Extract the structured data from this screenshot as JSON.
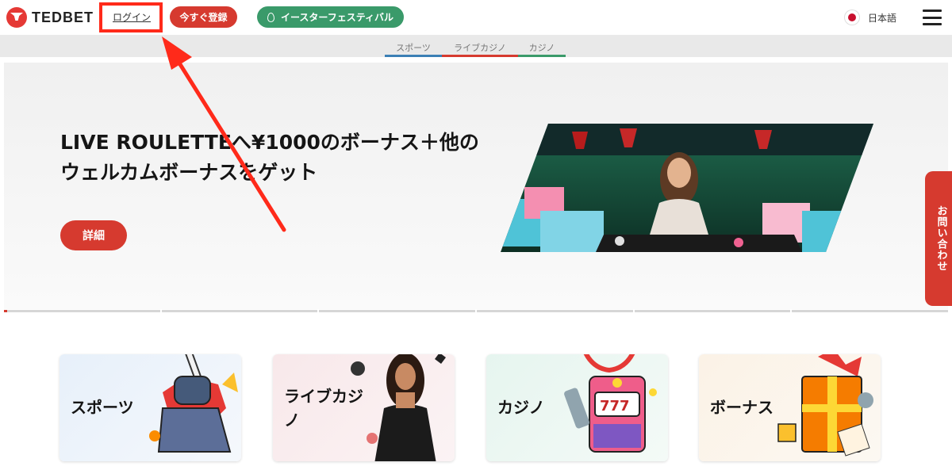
{
  "header": {
    "logo_text": "TEDBET",
    "login_label": "ログイン",
    "register_label": "今すぐ登録",
    "easter_label": "イースターフェスティバル",
    "language_label": "日本語"
  },
  "subnav": {
    "tabs": [
      {
        "label": "スポーツ",
        "color": "#3b7fb5"
      },
      {
        "label": "ライブカジノ",
        "color": "#d63a2f"
      },
      {
        "label": "カジノ",
        "color": "#3a9a6a"
      }
    ]
  },
  "hero": {
    "title_line1": "LIVE ROULETTEへ¥1000のボーナス＋他の",
    "title_line2": "ウェルカムボーナスをゲット",
    "detail_label": "詳細"
  },
  "contact_label": "お問い合わせ",
  "cards": [
    {
      "label": "スポーツ"
    },
    {
      "label_line1": "ライブカジ",
      "label_line2": "ノ"
    },
    {
      "label": "カジノ"
    },
    {
      "label": "ボーナス"
    }
  ],
  "colors": {
    "accent_red": "#d63a2f",
    "easter_green": "#3a9a6a",
    "annotation_red": "#ff2a1a"
  }
}
